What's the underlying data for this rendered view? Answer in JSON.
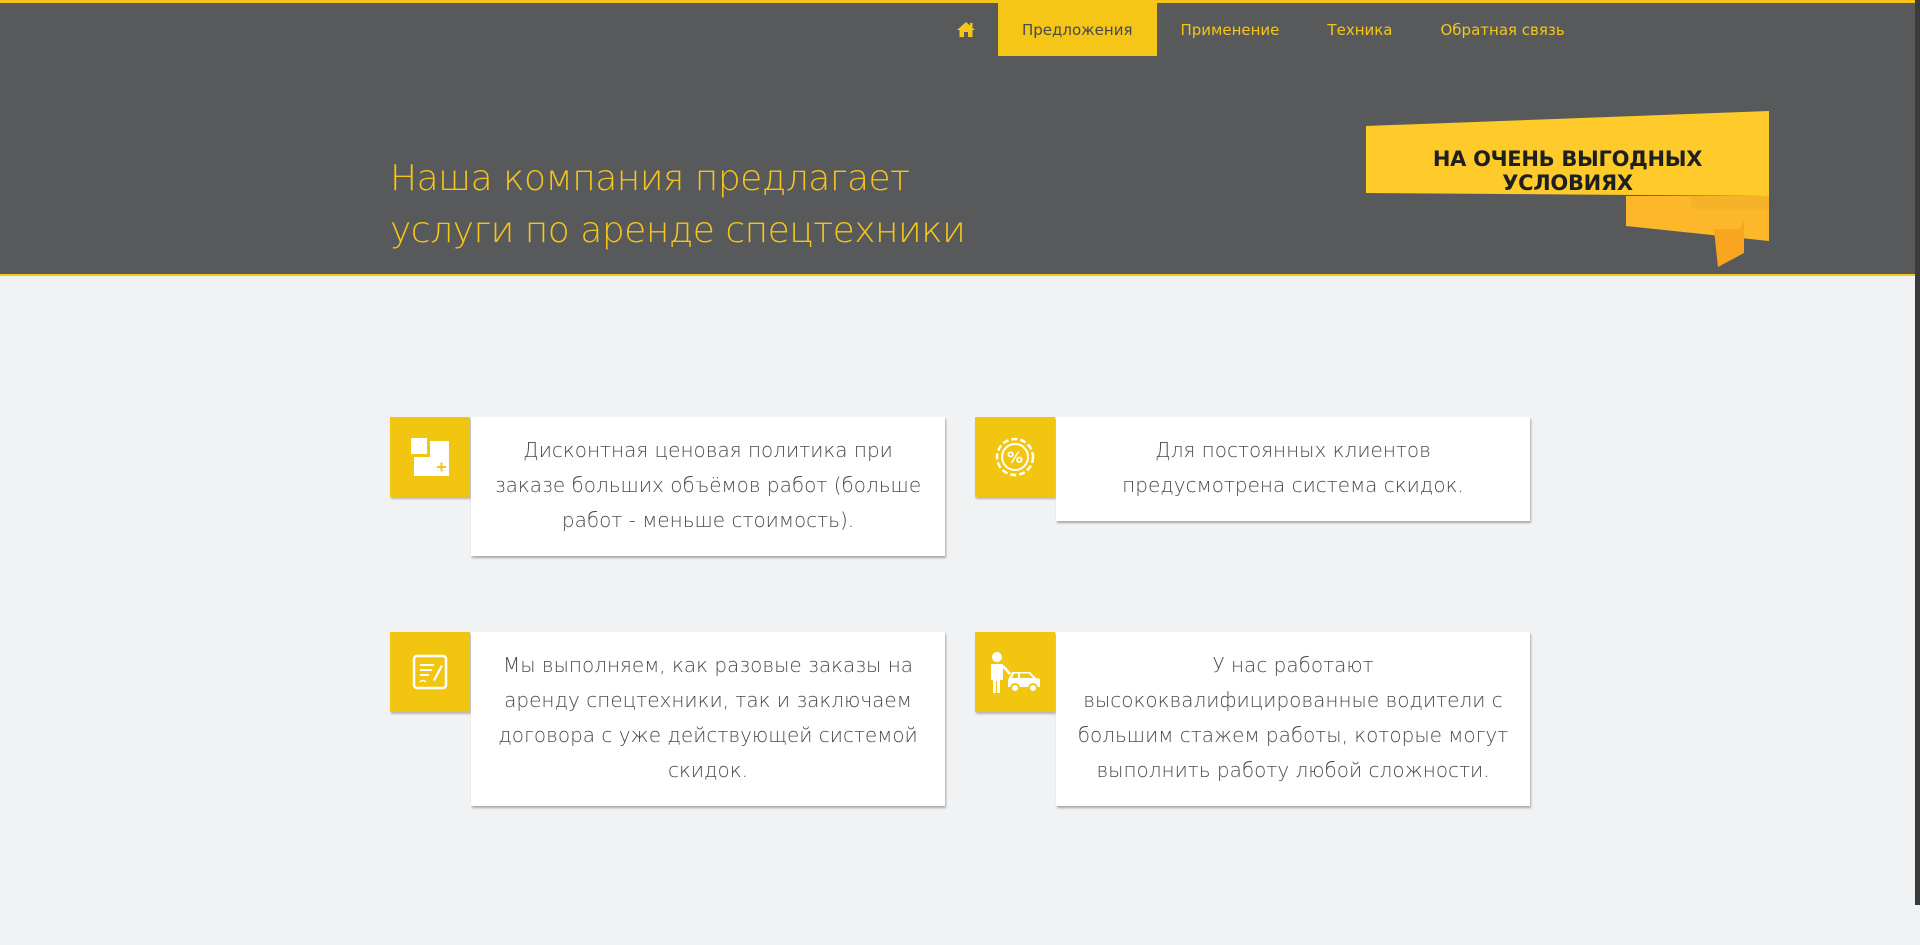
{
  "nav": {
    "home_icon": "home-icon",
    "items": [
      {
        "label": "Предложения",
        "active": true
      },
      {
        "label": "Применение",
        "active": false
      },
      {
        "label": "Техника",
        "active": false
      },
      {
        "label": "Обратная связь",
        "active": false
      }
    ]
  },
  "hero": {
    "title_line1": "Наша компания предлагает",
    "title_line2": "услуги по аренде спецтехники",
    "ribbon_text": "НА ОЧЕНЬ ВЫГОДНЫХ УСЛОВИЯХ"
  },
  "cards": [
    {
      "icon": "add-squares-icon",
      "text": "Дисконтная ценовая политика при заказе больших объёмов работ (больше работ - меньше стоимость)."
    },
    {
      "icon": "percent-badge-icon",
      "text": "Для постоянных клиентов предусмотрена система скидок."
    },
    {
      "icon": "contract-icon",
      "text": "Мы выполняем, как разовые заказы на аренду спецтехники, так и заключаем договора с уже действующей системой скидок."
    },
    {
      "icon": "driver-car-icon",
      "text": "У нас работают высококвалифицированные водители с большим стажем работы, которые могут выполнить работу любой сложности."
    }
  ],
  "colors": {
    "accent": "#f5c518",
    "header_bg": "#58595b",
    "page_bg": "#f1f2f4"
  }
}
